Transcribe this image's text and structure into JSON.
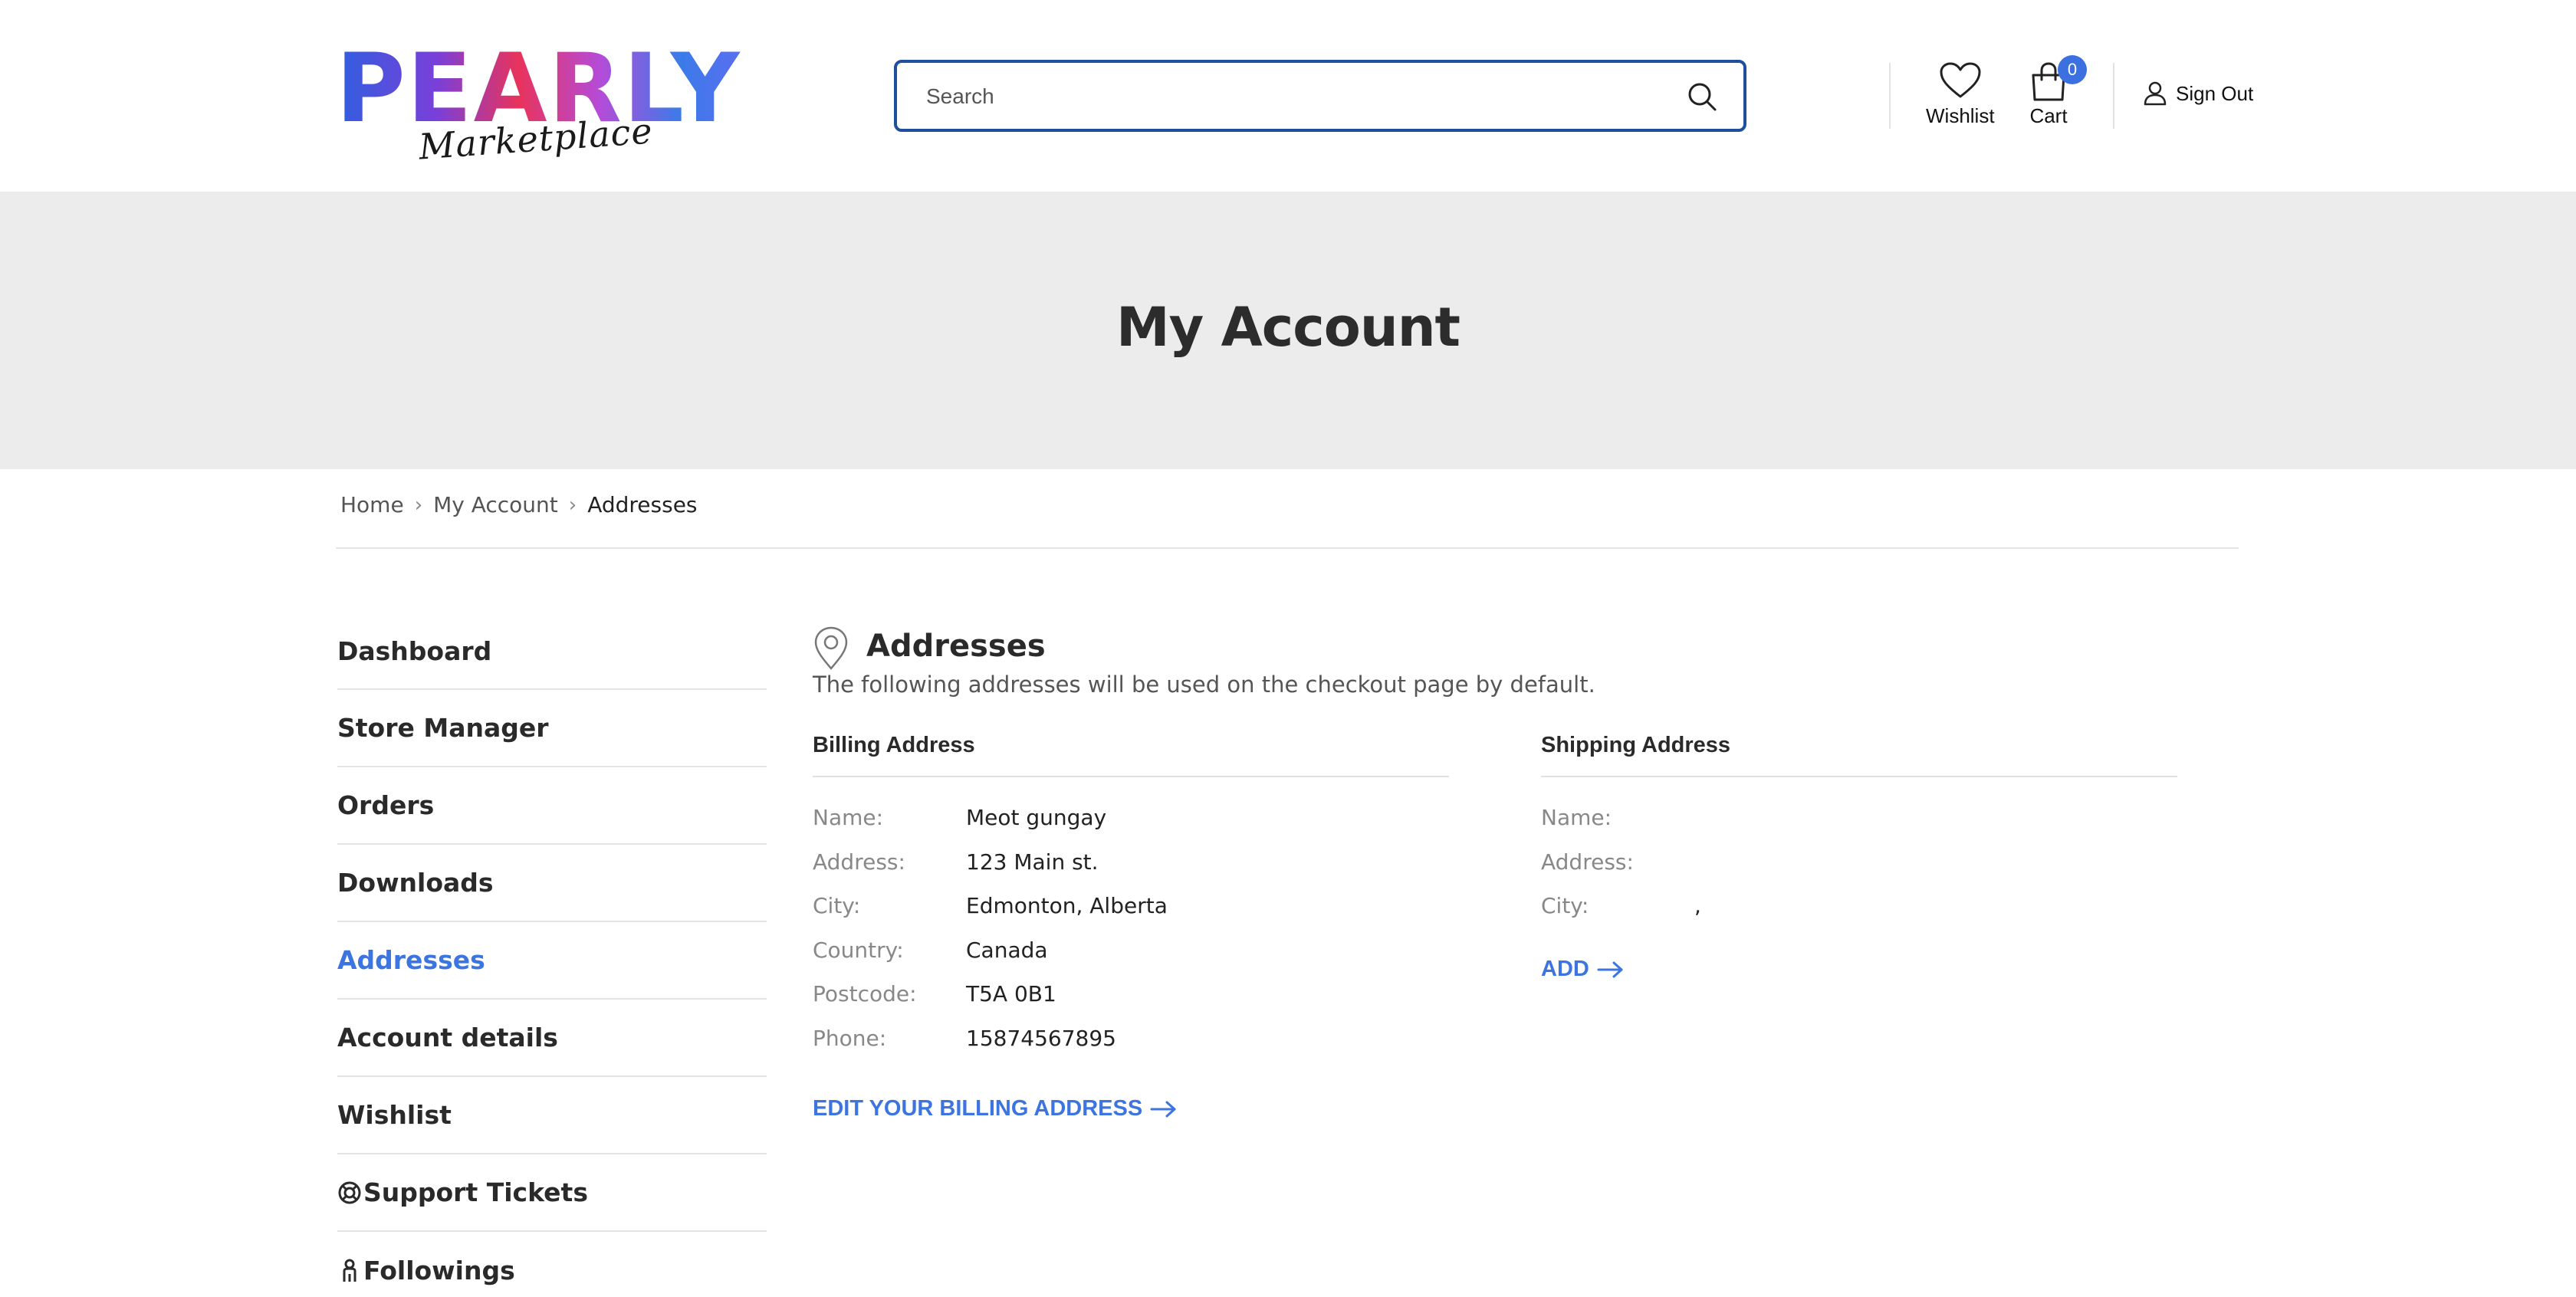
{
  "brand": {
    "word": "PEARLY",
    "sub": "Marketplace",
    "gradient": [
      "#2f5fe0",
      "#7a3fd9",
      "#e8335c",
      "#b54bd8",
      "#3b7be8"
    ]
  },
  "header": {
    "search_placeholder": "Search",
    "wishlist_label": "Wishlist",
    "cart_label": "Cart",
    "cart_count": "0",
    "signout_label": "Sign Out"
  },
  "banner": {
    "title": "My Account"
  },
  "breadcrumb": {
    "items": [
      "Home",
      "My Account",
      "Addresses"
    ]
  },
  "sidebar": {
    "items": [
      {
        "label": "Dashboard",
        "active": false
      },
      {
        "label": "Store Manager",
        "active": false
      },
      {
        "label": "Orders",
        "active": false
      },
      {
        "label": "Downloads",
        "active": false
      },
      {
        "label": "Addresses",
        "active": true
      },
      {
        "label": "Account details",
        "active": false
      },
      {
        "label": "Wishlist",
        "active": false
      },
      {
        "label": "Support Tickets",
        "active": false,
        "icon": "lifebuoy-icon"
      },
      {
        "label": "Followings",
        "active": false,
        "icon": "person-icon"
      }
    ]
  },
  "main": {
    "title": "Addresses",
    "description": "The following addresses will be used on the checkout page by default.",
    "billing": {
      "heading": "Billing Address",
      "rows": [
        {
          "key": "Name:",
          "value": "Meot gungay"
        },
        {
          "key": "Address:",
          "value": "123 Main st."
        },
        {
          "key": "City:",
          "value": "Edmonton, Alberta"
        },
        {
          "key": "Country:",
          "value": "Canada"
        },
        {
          "key": "Postcode:",
          "value": "T5A 0B1"
        },
        {
          "key": "Phone:",
          "value": "15874567895"
        }
      ],
      "action": "EDIT YOUR BILLING ADDRESS"
    },
    "shipping": {
      "heading": "Shipping Address",
      "rows": [
        {
          "key": "Name:",
          "value": ""
        },
        {
          "key": "Address:",
          "value": ""
        },
        {
          "key": "City:",
          "value": ","
        }
      ],
      "action": "ADD"
    }
  },
  "colors": {
    "accent": "#3c74e0",
    "search_border": "#1f4f9a",
    "banner_bg": "#ececec"
  }
}
